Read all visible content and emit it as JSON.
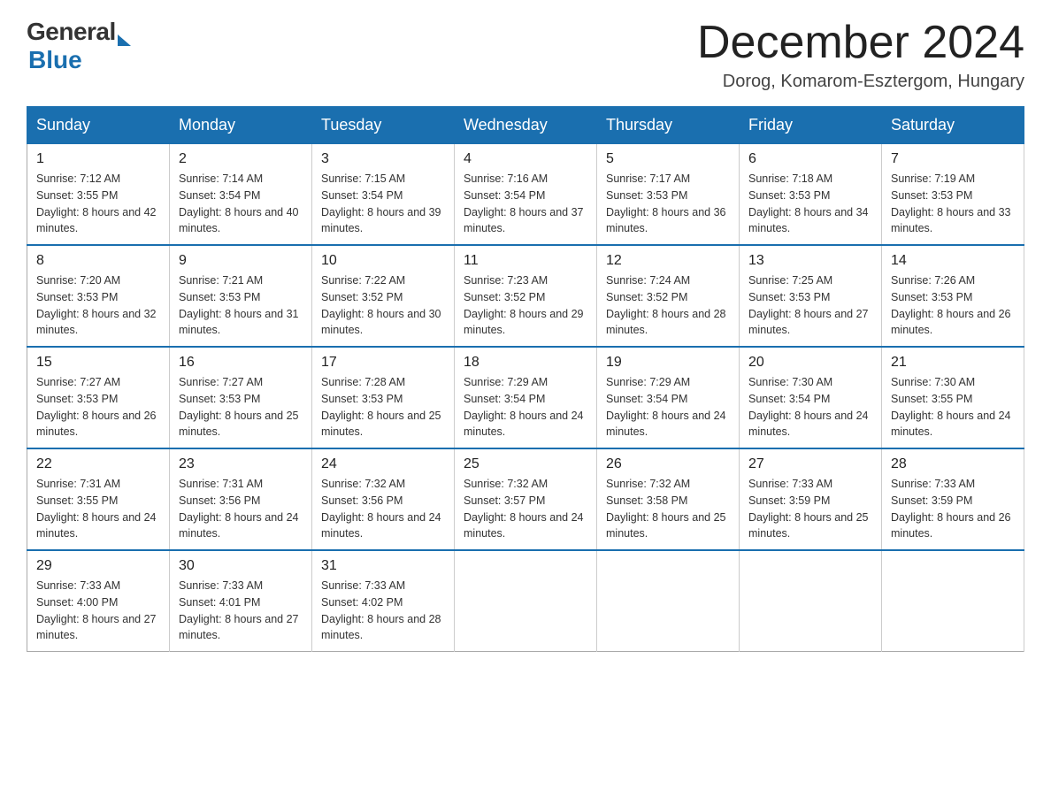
{
  "header": {
    "title": "December 2024",
    "subtitle": "Dorog, Komarom-Esztergom, Hungary",
    "logo_general": "General",
    "logo_blue": "Blue"
  },
  "calendar": {
    "days_of_week": [
      "Sunday",
      "Monday",
      "Tuesday",
      "Wednesday",
      "Thursday",
      "Friday",
      "Saturday"
    ],
    "weeks": [
      [
        {
          "date": "1",
          "sunrise": "7:12 AM",
          "sunset": "3:55 PM",
          "daylight": "8 hours and 42 minutes."
        },
        {
          "date": "2",
          "sunrise": "7:14 AM",
          "sunset": "3:54 PM",
          "daylight": "8 hours and 40 minutes."
        },
        {
          "date": "3",
          "sunrise": "7:15 AM",
          "sunset": "3:54 PM",
          "daylight": "8 hours and 39 minutes."
        },
        {
          "date": "4",
          "sunrise": "7:16 AM",
          "sunset": "3:54 PM",
          "daylight": "8 hours and 37 minutes."
        },
        {
          "date": "5",
          "sunrise": "7:17 AM",
          "sunset": "3:53 PM",
          "daylight": "8 hours and 36 minutes."
        },
        {
          "date": "6",
          "sunrise": "7:18 AM",
          "sunset": "3:53 PM",
          "daylight": "8 hours and 34 minutes."
        },
        {
          "date": "7",
          "sunrise": "7:19 AM",
          "sunset": "3:53 PM",
          "daylight": "8 hours and 33 minutes."
        }
      ],
      [
        {
          "date": "8",
          "sunrise": "7:20 AM",
          "sunset": "3:53 PM",
          "daylight": "8 hours and 32 minutes."
        },
        {
          "date": "9",
          "sunrise": "7:21 AM",
          "sunset": "3:53 PM",
          "daylight": "8 hours and 31 minutes."
        },
        {
          "date": "10",
          "sunrise": "7:22 AM",
          "sunset": "3:52 PM",
          "daylight": "8 hours and 30 minutes."
        },
        {
          "date": "11",
          "sunrise": "7:23 AM",
          "sunset": "3:52 PM",
          "daylight": "8 hours and 29 minutes."
        },
        {
          "date": "12",
          "sunrise": "7:24 AM",
          "sunset": "3:52 PM",
          "daylight": "8 hours and 28 minutes."
        },
        {
          "date": "13",
          "sunrise": "7:25 AM",
          "sunset": "3:53 PM",
          "daylight": "8 hours and 27 minutes."
        },
        {
          "date": "14",
          "sunrise": "7:26 AM",
          "sunset": "3:53 PM",
          "daylight": "8 hours and 26 minutes."
        }
      ],
      [
        {
          "date": "15",
          "sunrise": "7:27 AM",
          "sunset": "3:53 PM",
          "daylight": "8 hours and 26 minutes."
        },
        {
          "date": "16",
          "sunrise": "7:27 AM",
          "sunset": "3:53 PM",
          "daylight": "8 hours and 25 minutes."
        },
        {
          "date": "17",
          "sunrise": "7:28 AM",
          "sunset": "3:53 PM",
          "daylight": "8 hours and 25 minutes."
        },
        {
          "date": "18",
          "sunrise": "7:29 AM",
          "sunset": "3:54 PM",
          "daylight": "8 hours and 24 minutes."
        },
        {
          "date": "19",
          "sunrise": "7:29 AM",
          "sunset": "3:54 PM",
          "daylight": "8 hours and 24 minutes."
        },
        {
          "date": "20",
          "sunrise": "7:30 AM",
          "sunset": "3:54 PM",
          "daylight": "8 hours and 24 minutes."
        },
        {
          "date": "21",
          "sunrise": "7:30 AM",
          "sunset": "3:55 PM",
          "daylight": "8 hours and 24 minutes."
        }
      ],
      [
        {
          "date": "22",
          "sunrise": "7:31 AM",
          "sunset": "3:55 PM",
          "daylight": "8 hours and 24 minutes."
        },
        {
          "date": "23",
          "sunrise": "7:31 AM",
          "sunset": "3:56 PM",
          "daylight": "8 hours and 24 minutes."
        },
        {
          "date": "24",
          "sunrise": "7:32 AM",
          "sunset": "3:56 PM",
          "daylight": "8 hours and 24 minutes."
        },
        {
          "date": "25",
          "sunrise": "7:32 AM",
          "sunset": "3:57 PM",
          "daylight": "8 hours and 24 minutes."
        },
        {
          "date": "26",
          "sunrise": "7:32 AM",
          "sunset": "3:58 PM",
          "daylight": "8 hours and 25 minutes."
        },
        {
          "date": "27",
          "sunrise": "7:33 AM",
          "sunset": "3:59 PM",
          "daylight": "8 hours and 25 minutes."
        },
        {
          "date": "28",
          "sunrise": "7:33 AM",
          "sunset": "3:59 PM",
          "daylight": "8 hours and 26 minutes."
        }
      ],
      [
        {
          "date": "29",
          "sunrise": "7:33 AM",
          "sunset": "4:00 PM",
          "daylight": "8 hours and 27 minutes."
        },
        {
          "date": "30",
          "sunrise": "7:33 AM",
          "sunset": "4:01 PM",
          "daylight": "8 hours and 27 minutes."
        },
        {
          "date": "31",
          "sunrise": "7:33 AM",
          "sunset": "4:02 PM",
          "daylight": "8 hours and 28 minutes."
        },
        null,
        null,
        null,
        null
      ]
    ]
  }
}
